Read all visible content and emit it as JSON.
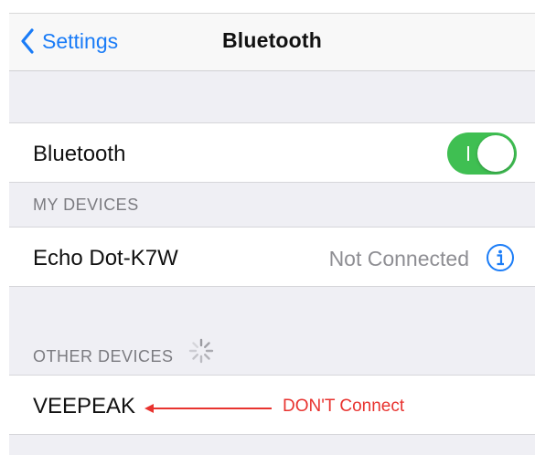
{
  "navbar": {
    "back_label": "Settings",
    "title": "Bluetooth"
  },
  "bluetooth_row": {
    "label": "Bluetooth",
    "toggle_state": "on"
  },
  "my_devices": {
    "header": "MY DEVICES",
    "devices": [
      {
        "name": "Echo Dot-K7W",
        "status": "Not Connected",
        "icon": "info-icon"
      }
    ]
  },
  "other_devices": {
    "header": "OTHER DEVICES",
    "spinner_icon": "activity-spinner-icon",
    "devices": [
      {
        "name": "VEEPEAK"
      }
    ]
  },
  "annotation": {
    "text": "DON'T Connect"
  },
  "colors": {
    "accent": "#1a7cf7",
    "toggle_on": "#3fbf52",
    "annotation": "#e8332f"
  }
}
